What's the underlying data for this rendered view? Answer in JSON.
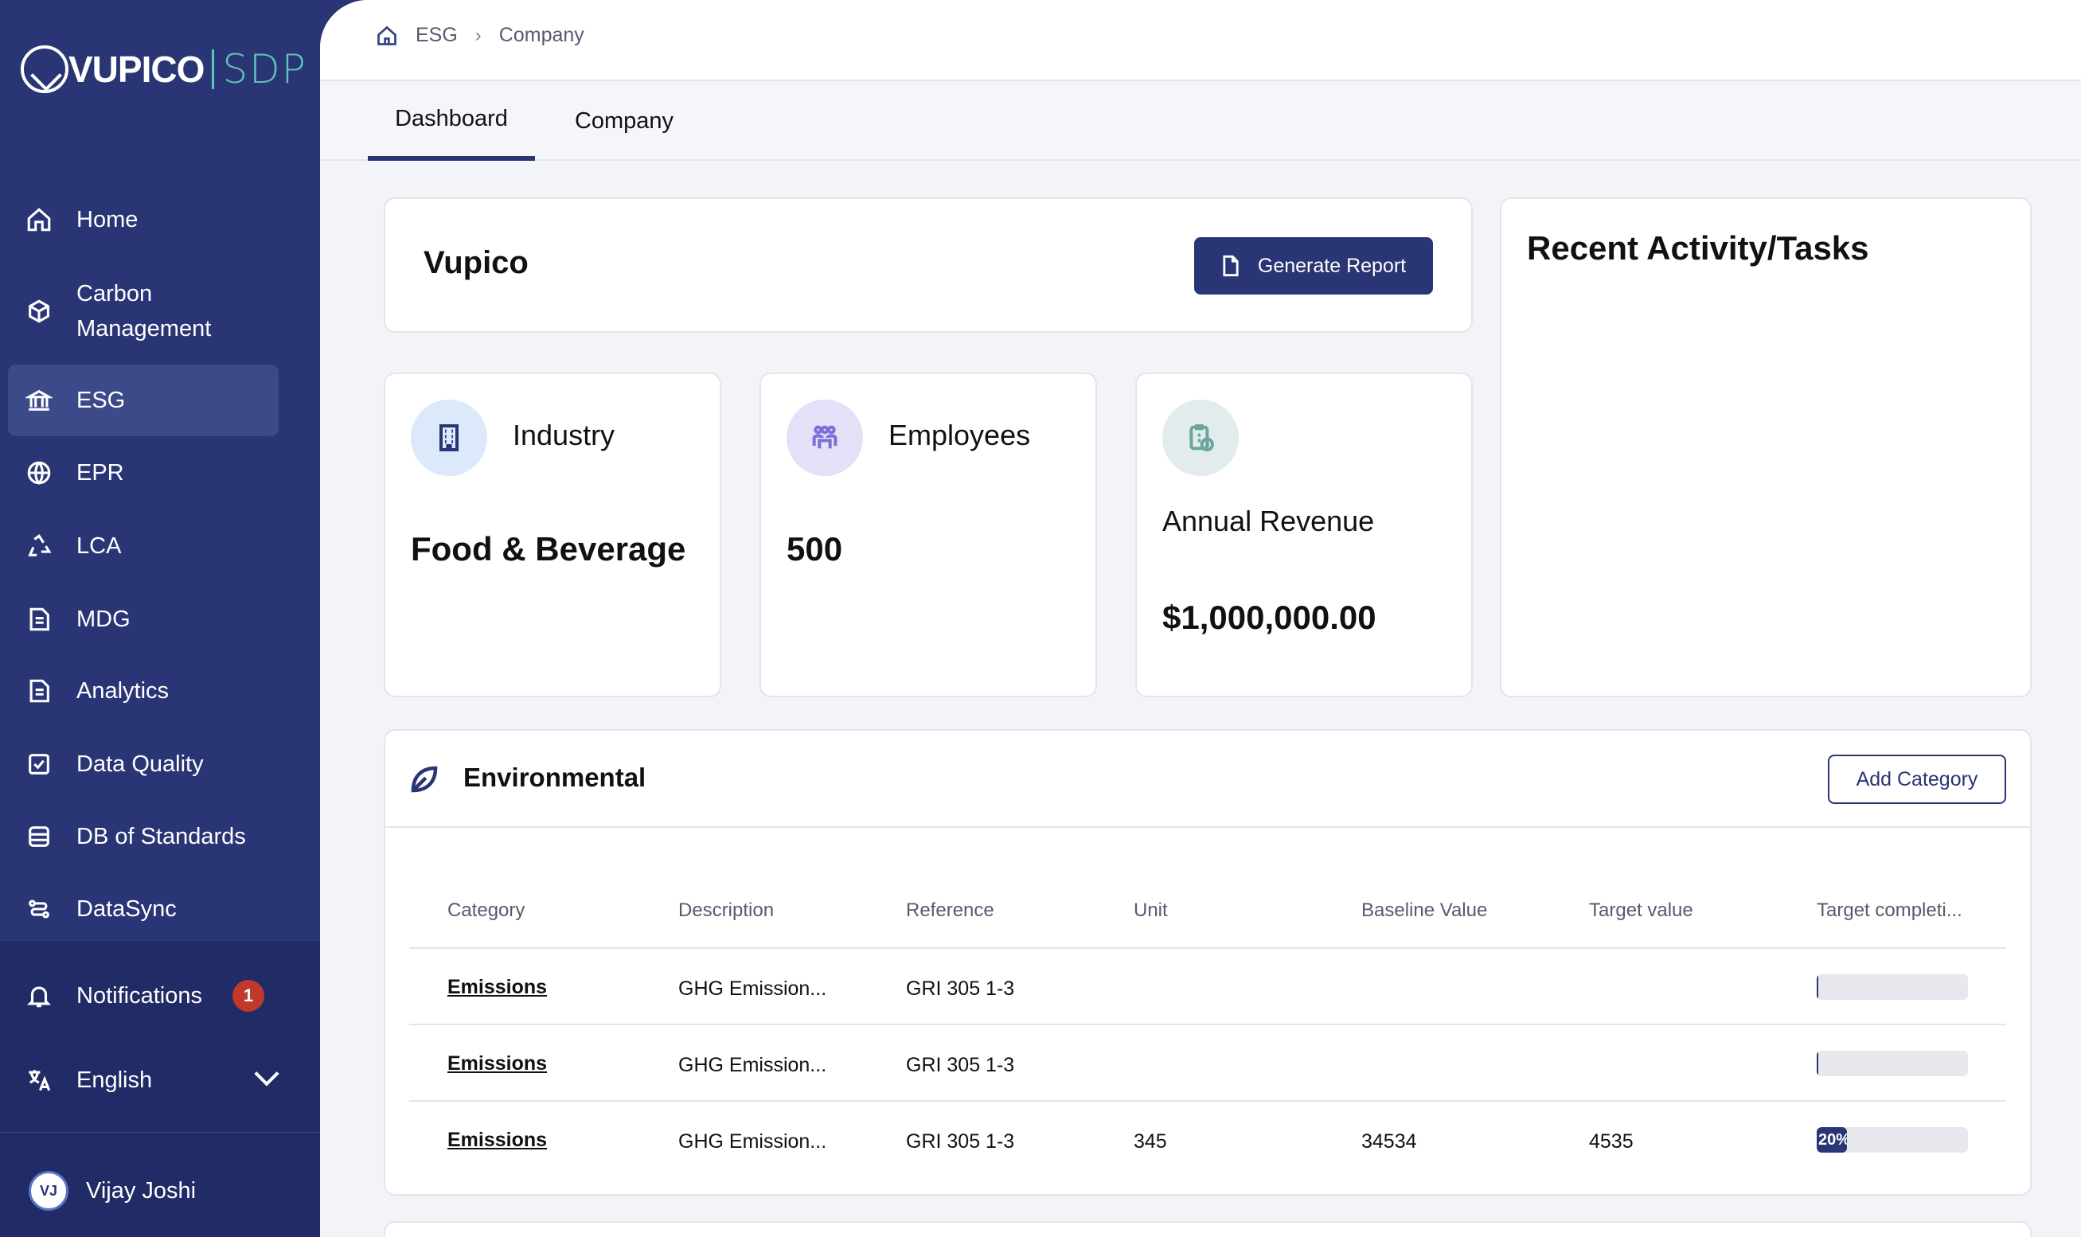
{
  "brand": {
    "logo_text": "VUPICO",
    "product": "SDP",
    "accent": "#5ec3b8",
    "primary": "#2a3575"
  },
  "sidebar": {
    "items": [
      {
        "label": "Home",
        "icon": "home-icon"
      },
      {
        "label": "Carbon Management",
        "icon": "cube-icon"
      },
      {
        "label": "ESG",
        "icon": "bank-icon",
        "active": true
      },
      {
        "label": "EPR",
        "icon": "globe-icon"
      },
      {
        "label": "LCA",
        "icon": "recycle-icon"
      },
      {
        "label": "MDG",
        "icon": "document-icon"
      },
      {
        "label": "Analytics",
        "icon": "document-icon"
      },
      {
        "label": "Data Quality",
        "icon": "checkbox-icon"
      },
      {
        "label": "DB of Standards",
        "icon": "database-icon"
      },
      {
        "label": "DataSync",
        "icon": "sync-icon"
      }
    ],
    "notifications": {
      "label": "Notifications",
      "count": "1"
    },
    "language": {
      "label": "English"
    },
    "user": {
      "initials": "VJ",
      "name": "Vijay Joshi"
    }
  },
  "breadcrumb": {
    "items": [
      "ESG",
      "Company"
    ]
  },
  "tabs": [
    {
      "label": "Dashboard",
      "active": true
    },
    {
      "label": "Company"
    }
  ],
  "company": {
    "name": "Vupico",
    "generate_report_label": "Generate Report"
  },
  "stats": {
    "industry": {
      "label": "Industry",
      "value": "Food & Beverage"
    },
    "employees": {
      "label": "Employees",
      "value": "500"
    },
    "revenue": {
      "label": "Annual Revenue",
      "value": "$1,000,000.00"
    }
  },
  "recent": {
    "title": "Recent Activity/Tasks"
  },
  "environmental": {
    "title": "Environmental",
    "add_label": "Add Category",
    "columns": [
      "Category",
      "Description",
      "Reference",
      "Unit",
      "Baseline Value",
      "Target value",
      "Target completi..."
    ],
    "rows": [
      {
        "category": "Emissions",
        "description": "GHG Emission...",
        "reference": "GRI 305 1-3",
        "unit": "",
        "baseline": "",
        "target": "",
        "completion": null,
        "completion_label": ""
      },
      {
        "category": "Emissions",
        "description": "GHG Emission...",
        "reference": "GRI 305 1-3",
        "unit": "",
        "baseline": "",
        "target": "",
        "completion": null,
        "completion_label": ""
      },
      {
        "category": "Emissions",
        "description": "GHG Emission...",
        "reference": "GRI 305 1-3",
        "unit": "345",
        "baseline": "34534",
        "target": "4535",
        "completion": 0.2,
        "completion_label": "20%"
      }
    ]
  }
}
